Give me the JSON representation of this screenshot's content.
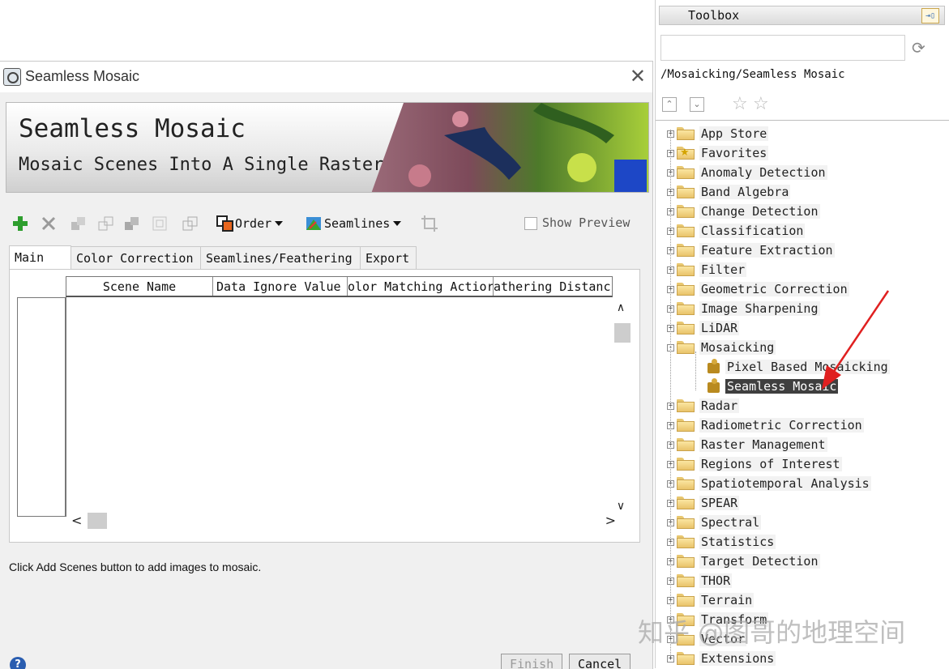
{
  "dialog": {
    "title": "Seamless Mosaic",
    "banner_title": "Seamless Mosaic",
    "banner_subtitle": "Mosaic Scenes Into A Single Raster",
    "toolbar": {
      "order_label": "Order",
      "seamlines_label": "Seamlines",
      "show_preview_label": "Show Preview",
      "show_preview_checked": false
    },
    "tabs": [
      {
        "label": "Main",
        "active": true
      },
      {
        "label": "Color Correction",
        "active": false
      },
      {
        "label": "Seamlines/Feathering",
        "active": false
      },
      {
        "label": "Export",
        "active": false
      }
    ],
    "table": {
      "columns": [
        "Scene Name",
        "Data Ignore Value",
        "olor Matching Actior",
        "athering Distanc"
      ],
      "rows": []
    },
    "status_message": "Click Add Scenes button to add images to mosaic.",
    "help_symbol": "?",
    "buttons": {
      "finish": "Finish",
      "cancel": "Cancel"
    }
  },
  "toolbox": {
    "title": "Toolbox",
    "search_value": "",
    "path": "/Mosaicking/Seamless Mosaic",
    "tree": [
      {
        "label": "App Store",
        "type": "folder",
        "expanded": false
      },
      {
        "label": "Favorites",
        "type": "favorites",
        "expanded": false
      },
      {
        "label": "Anomaly Detection",
        "type": "folder",
        "expanded": false
      },
      {
        "label": "Band Algebra",
        "type": "folder",
        "expanded": false
      },
      {
        "label": "Change Detection",
        "type": "folder",
        "expanded": false
      },
      {
        "label": "Classification",
        "type": "folder",
        "expanded": false
      },
      {
        "label": "Feature Extraction",
        "type": "folder",
        "expanded": false
      },
      {
        "label": "Filter",
        "type": "folder",
        "expanded": false
      },
      {
        "label": "Geometric Correction",
        "type": "folder",
        "expanded": false
      },
      {
        "label": "Image Sharpening",
        "type": "folder",
        "expanded": false
      },
      {
        "label": "LiDAR",
        "type": "folder",
        "expanded": false
      },
      {
        "label": "Mosaicking",
        "type": "folder",
        "expanded": true
      },
      {
        "label": "Pixel Based Mosaicking",
        "type": "tool",
        "expanded": false
      },
      {
        "label": "Seamless Mosaic",
        "type": "tool",
        "selected": true
      },
      {
        "label": "Radar",
        "type": "folder",
        "expanded": false
      },
      {
        "label": "Radiometric Correction",
        "type": "folder",
        "expanded": false
      },
      {
        "label": "Raster Management",
        "type": "folder",
        "expanded": false
      },
      {
        "label": "Regions of Interest",
        "type": "folder",
        "expanded": false
      },
      {
        "label": "Spatiotemporal Analysis",
        "type": "folder",
        "expanded": false
      },
      {
        "label": "SPEAR",
        "type": "folder",
        "expanded": false
      },
      {
        "label": "Spectral",
        "type": "folder",
        "expanded": false
      },
      {
        "label": "Statistics",
        "type": "folder",
        "expanded": false
      },
      {
        "label": "Target Detection",
        "type": "folder",
        "expanded": false
      },
      {
        "label": "THOR",
        "type": "folder",
        "expanded": false
      },
      {
        "label": "Terrain",
        "type": "folder",
        "expanded": false
      },
      {
        "label": "Transform",
        "type": "folder",
        "expanded": false
      },
      {
        "label": "Vector",
        "type": "folder",
        "expanded": false
      },
      {
        "label": "Extensions",
        "type": "folder",
        "expanded": false
      }
    ]
  },
  "watermark": "知乎 @图哥的地理空间",
  "colors": {
    "accent_red": "#e02020",
    "selection": "#3f3f3f",
    "add_green": "#2e9e2e"
  }
}
